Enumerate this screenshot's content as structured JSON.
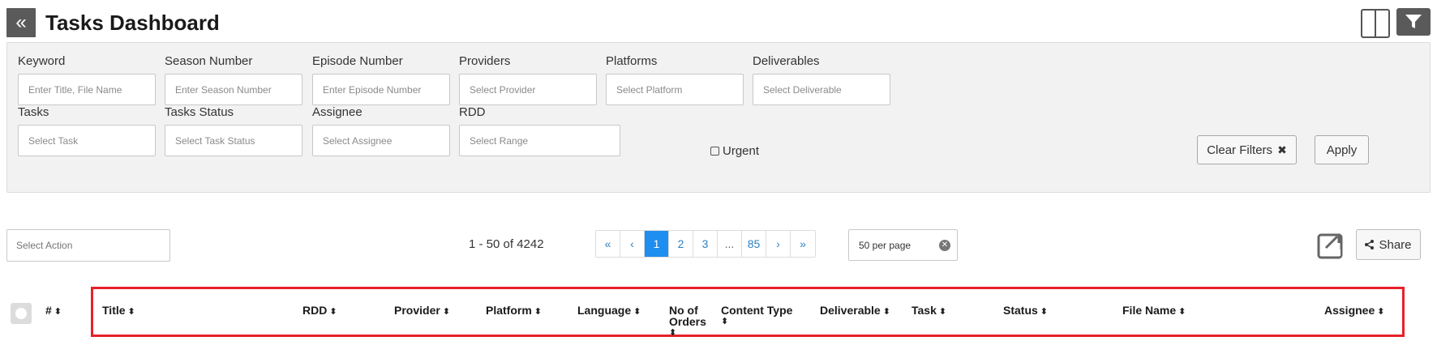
{
  "header": {
    "back_icon": "double-chevron-left-icon",
    "title": "Tasks Dashboard",
    "columns_icon": "columns-layout-icon",
    "filter_icon": "funnel-icon"
  },
  "filters": {
    "keyword": {
      "label": "Keyword",
      "placeholder": "Enter Title, File Name"
    },
    "season": {
      "label": "Season Number",
      "placeholder": "Enter Season Number"
    },
    "episode": {
      "label": "Episode Number",
      "placeholder": "Enter Episode Number"
    },
    "providers": {
      "label": "Providers",
      "placeholder": "Select Provider"
    },
    "platforms": {
      "label": "Platforms",
      "placeholder": "Select Platform"
    },
    "deliverables": {
      "label": "Deliverables",
      "placeholder": "Select Deliverable"
    },
    "tasks": {
      "label": "Tasks",
      "placeholder": "Select Task"
    },
    "task_status": {
      "label": "Tasks Status",
      "placeholder": "Select Task Status"
    },
    "assignee": {
      "label": "Assignee",
      "placeholder": "Select Assignee"
    },
    "rdd": {
      "label": "RDD",
      "placeholder": "Select Range"
    },
    "urgent_label": "Urgent",
    "clear_label": "Clear Filters",
    "apply_label": "Apply"
  },
  "actions": {
    "select_placeholder": "Select Action",
    "range_text": "1 - 50 of 4242",
    "pages": [
      "«",
      "‹",
      "1",
      "2",
      "3",
      "...",
      "85",
      "›",
      "»"
    ],
    "active_page": "1",
    "per_page": "50 per page",
    "share_label": "Share"
  },
  "table": {
    "columns": [
      "#",
      "Title",
      "RDD",
      "Provider",
      "Platform",
      "Language",
      "No of Orders",
      "Content Type",
      "Deliverable",
      "Task",
      "Status",
      "File Name",
      "Assignee"
    ],
    "highlight_color": "#e8202a"
  }
}
